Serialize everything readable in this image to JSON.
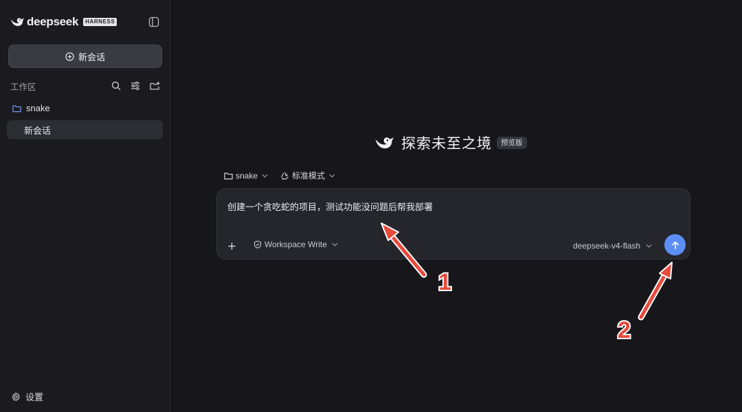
{
  "app": {
    "brand_name": "deepseek",
    "brand_badge": "HARNESS"
  },
  "sidebar": {
    "new_chat_label": "新会话",
    "workspace_label": "工作区",
    "projects": [
      {
        "name": "snake",
        "sessions": [
          {
            "label": "新会话",
            "active": true
          }
        ]
      }
    ],
    "settings_label": "设置"
  },
  "main": {
    "hero_title": "探索未至之境",
    "hero_badge": "预览版",
    "project_selector": "snake",
    "mode_selector": "标准模式",
    "composer": {
      "text": "创建一个贪吃蛇的项目，测试功能没问题后帮我部署",
      "permission_label": "Workspace Write",
      "model_label": "deepseek-v4-flash"
    }
  },
  "annotations": [
    {
      "label": "1",
      "color": "#e84a3c"
    },
    {
      "label": "2",
      "color": "#e84a3c"
    }
  ],
  "colors": {
    "accent_blue": "#5b8ff3",
    "sidebar_bg": "#1b1b1f",
    "main_bg": "#16161b",
    "annotation_red": "#e84a3c",
    "folder_blue": "#6e9cf0"
  }
}
